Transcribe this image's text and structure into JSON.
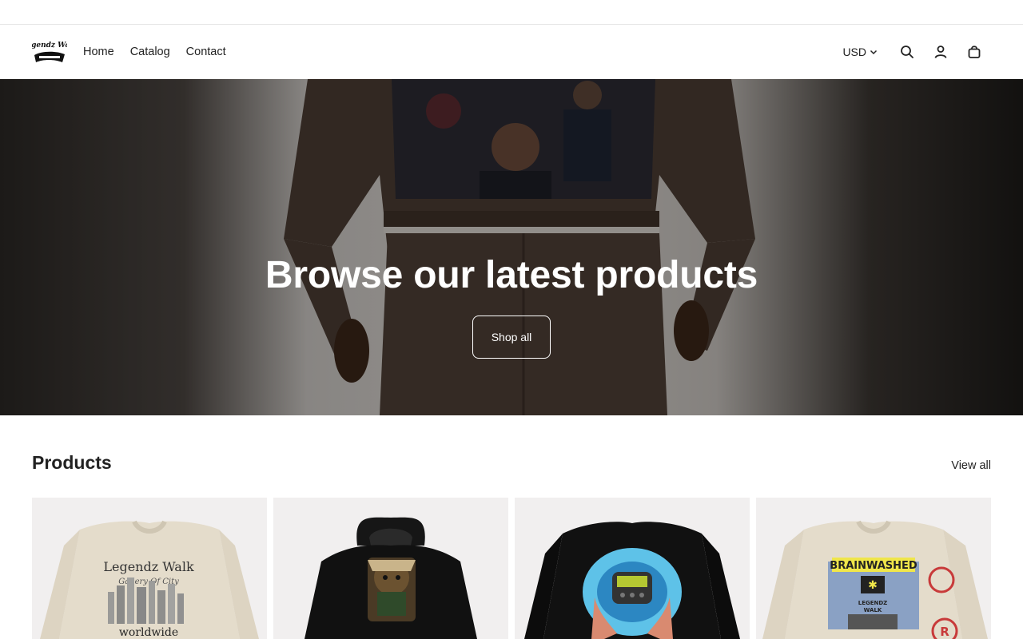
{
  "header": {
    "logo_text": "Legendz Walk",
    "nav": [
      {
        "label": "Home"
      },
      {
        "label": "Catalog"
      },
      {
        "label": "Contact"
      }
    ],
    "currency": "USD",
    "icons": [
      "search-icon",
      "account-icon",
      "cart-icon",
      "chevron-down-icon"
    ]
  },
  "hero": {
    "title": "Browse our latest products",
    "button_label": "Shop all"
  },
  "products": {
    "title": "Products",
    "view_all_label": "View all",
    "items": [
      {
        "print_line1": "Legendz Walk",
        "print_line2": "Gallery Of City",
        "print_line3": "worldwide"
      },
      {},
      {},
      {
        "print_line1": "BRAINWASHED",
        "print_line2": "LEGENDZ",
        "print_line3": "WALK"
      }
    ]
  },
  "colors": {
    "text": "#1a1a1a",
    "card_bg": "#f1efef",
    "sweater_cream": "#e4dccb",
    "hoodie_black": "#111111"
  }
}
